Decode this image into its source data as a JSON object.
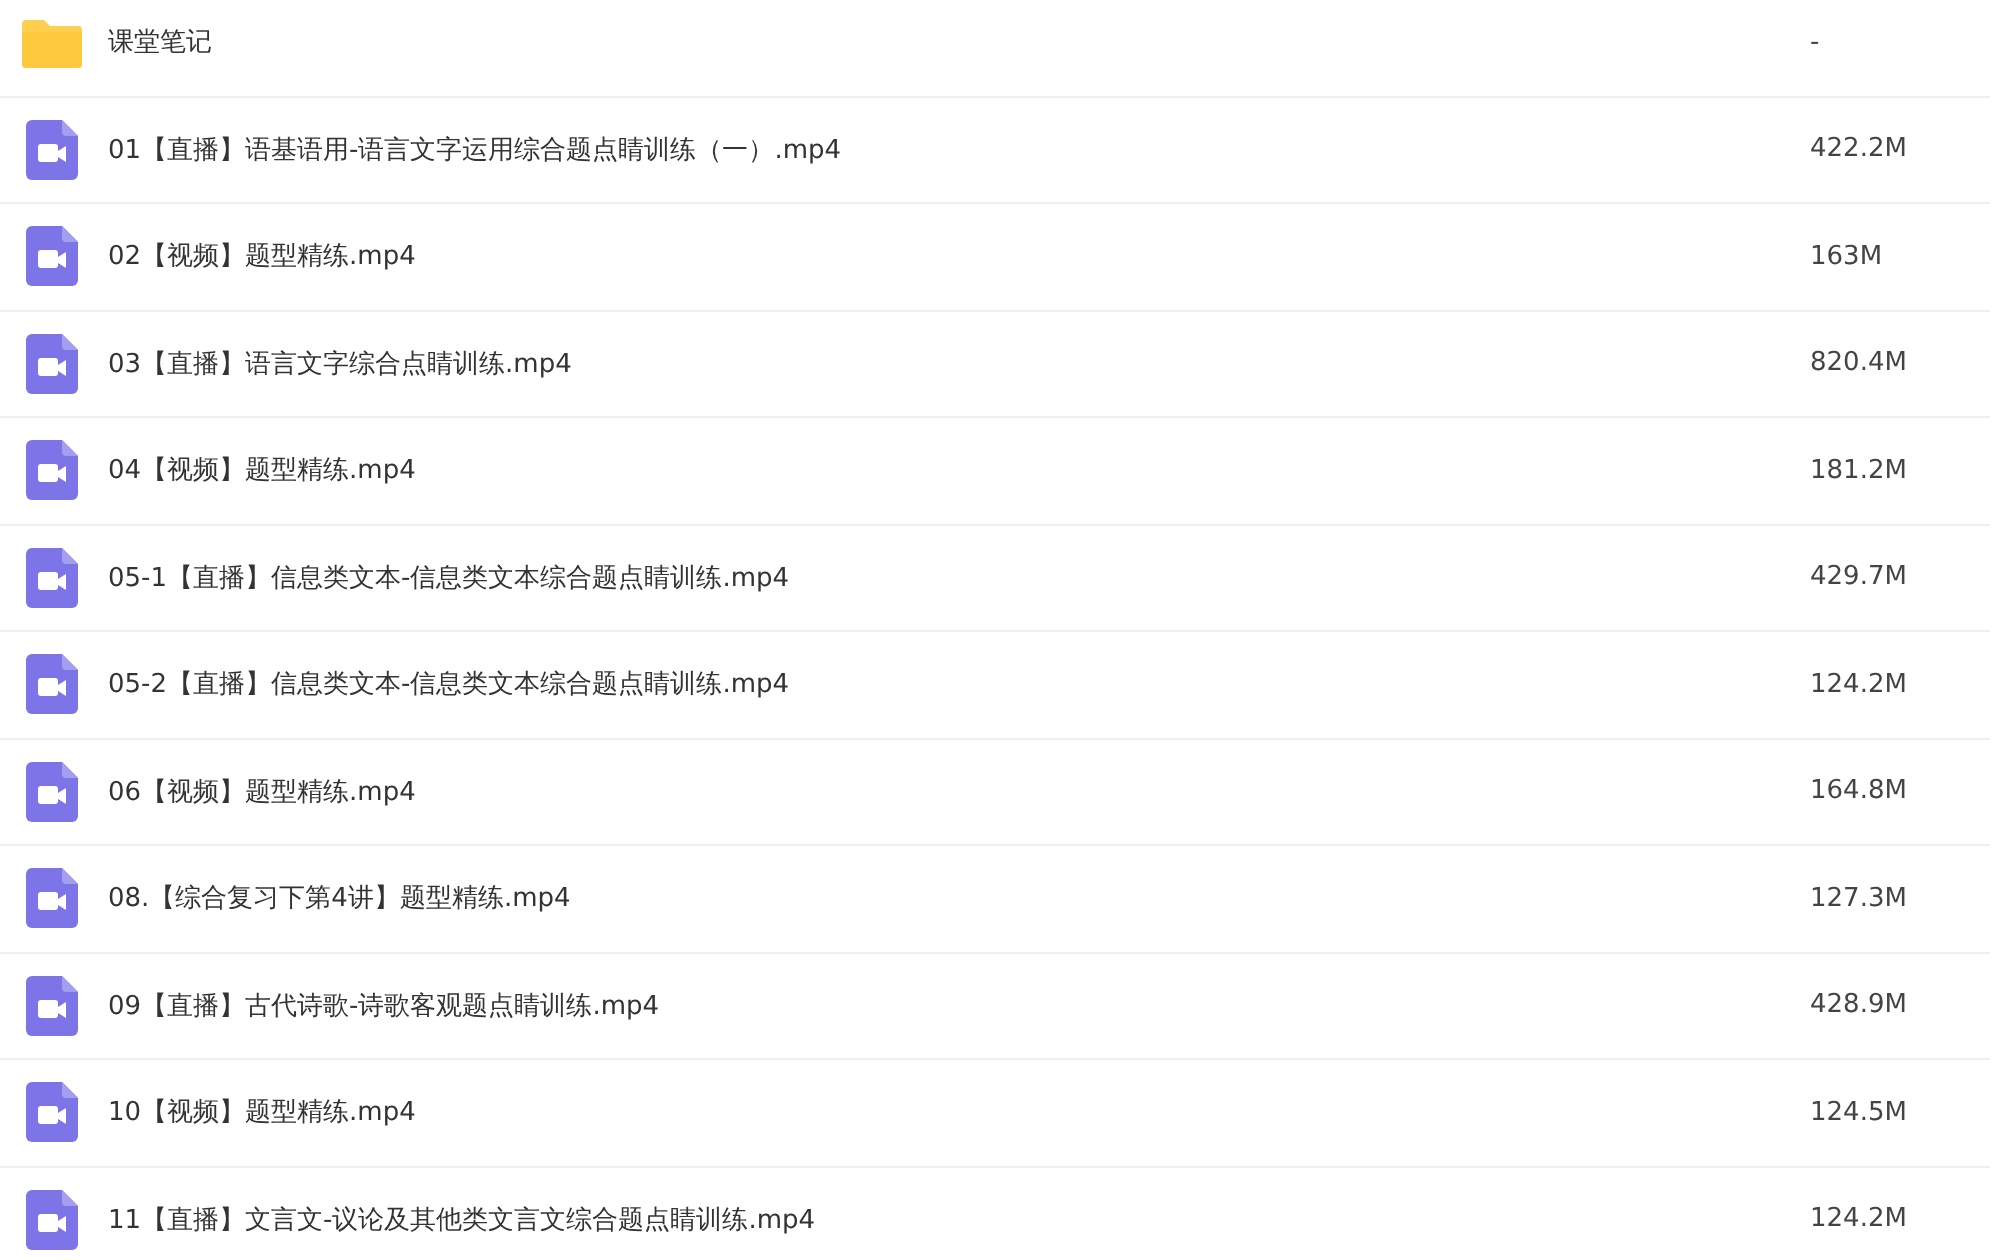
{
  "files": [
    {
      "kind": "folder",
      "name": "课堂笔记",
      "size": "-"
    },
    {
      "kind": "video",
      "name": "01【直播】语基语用-语言文字运用综合题点睛训练（一）.mp4",
      "size": "422.2M"
    },
    {
      "kind": "video",
      "name": "02【视频】题型精练.mp4",
      "size": "163M"
    },
    {
      "kind": "video",
      "name": "03【直播】语言文字综合点睛训练.mp4",
      "size": "820.4M"
    },
    {
      "kind": "video",
      "name": "04【视频】题型精练.mp4",
      "size": "181.2M"
    },
    {
      "kind": "video",
      "name": "05-1【直播】信息类文本-信息类文本综合题点睛训练.mp4",
      "size": "429.7M"
    },
    {
      "kind": "video",
      "name": "05-2【直播】信息类文本-信息类文本综合题点睛训练.mp4",
      "size": "124.2M"
    },
    {
      "kind": "video",
      "name": "06【视频】题型精练.mp4",
      "size": "164.8M"
    },
    {
      "kind": "video",
      "name": "08.【综合复习下第4讲】题型精练.mp4",
      "size": "127.3M"
    },
    {
      "kind": "video",
      "name": "09【直播】古代诗歌-诗歌客观题点睛训练.mp4",
      "size": "428.9M"
    },
    {
      "kind": "video",
      "name": "10【视频】题型精练.mp4",
      "size": "124.5M"
    },
    {
      "kind": "video",
      "name": "11【直播】文言文-议论及其他类文言文综合题点睛训练.mp4",
      "size": "124.2M"
    }
  ]
}
